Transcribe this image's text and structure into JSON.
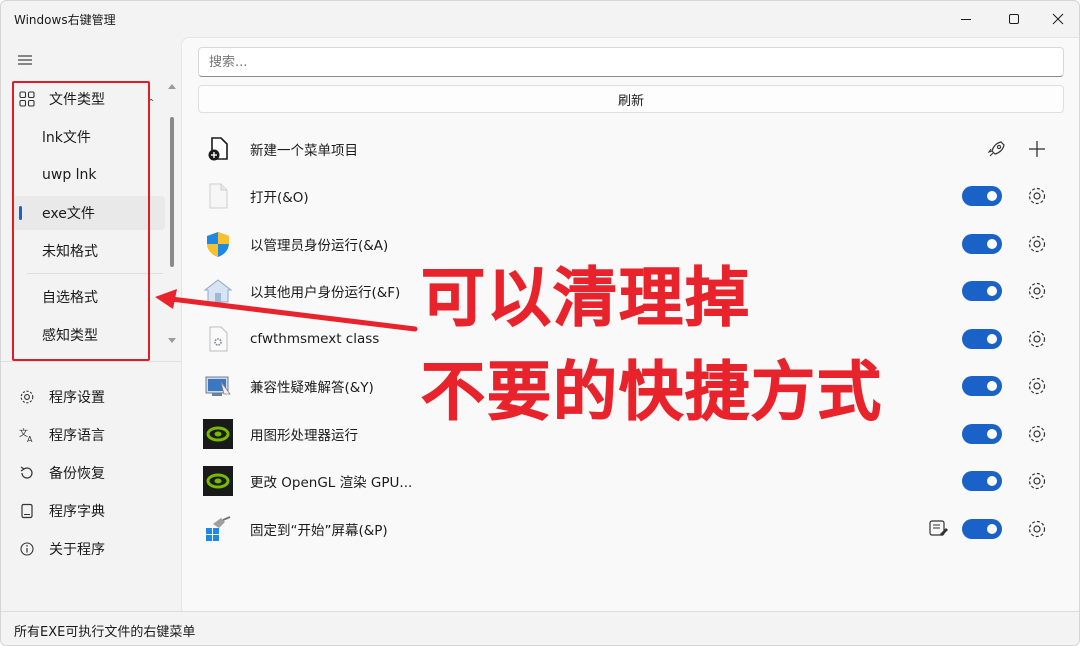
{
  "window": {
    "title": "Windows右键管理"
  },
  "sidebar": {
    "group": {
      "label": "文件类型",
      "icon": "grid-icon"
    },
    "sub_items": [
      {
        "label": "lnk文件"
      },
      {
        "label": "uwp lnk"
      },
      {
        "label": "exe文件",
        "selected": true
      },
      {
        "label": "未知格式"
      },
      {
        "label": "自选格式"
      },
      {
        "label": "感知类型"
      }
    ],
    "bottom_items": [
      {
        "label": "程序设置",
        "icon": "gear-icon"
      },
      {
        "label": "程序语言",
        "icon": "language-icon"
      },
      {
        "label": "备份恢复",
        "icon": "restore-icon"
      },
      {
        "label": "程序字典",
        "icon": "dictionary-icon"
      },
      {
        "label": "关于程序",
        "icon": "info-icon"
      }
    ]
  },
  "main": {
    "search_placeholder": "搜索...",
    "refresh_label": "刷新",
    "new_item_label": "新建一个菜单项目",
    "items": [
      {
        "label": "打开(&O)",
        "icon": "blank-file-icon",
        "enabled": true
      },
      {
        "label": "以管理员身份运行(&A)",
        "icon": "uac-shield-icon",
        "enabled": true
      },
      {
        "label": "以其他用户身份运行(&F)",
        "icon": "house-icon",
        "enabled": true
      },
      {
        "label": "cfwthmsmext class",
        "icon": "settings-file-icon",
        "enabled": true
      },
      {
        "label": "兼容性疑难解答(&Y)",
        "icon": "compat-troubleshoot-icon",
        "enabled": true
      },
      {
        "label": "用图形处理器运行",
        "icon": "nvidia-icon",
        "enabled": true
      },
      {
        "label": "更改 OpenGL 渲染 GPU...",
        "icon": "nvidia-icon",
        "enabled": true
      },
      {
        "label": "固定到“开始”屏幕(&P)",
        "icon": "pin-start-icon",
        "enabled": true
      }
    ]
  },
  "statusbar": {
    "text": "所有EXE可执行文件的右键菜单"
  },
  "annotation": {
    "line1": "可以清理掉",
    "line2": "不要的快捷方式",
    "color": "#e8232b"
  },
  "colors": {
    "accent": "#1a62c7",
    "annotation": "#e8232b"
  }
}
